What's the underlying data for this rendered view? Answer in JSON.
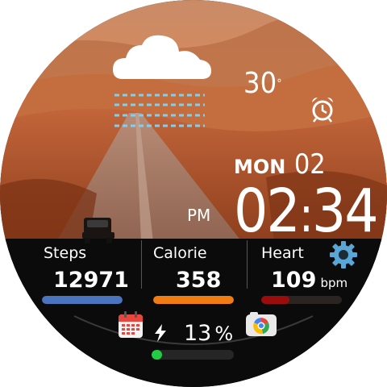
{
  "weather": {
    "icon": "rain-cloud-icon",
    "temperature": "30",
    "unit": "°"
  },
  "alarm": {
    "icon": "alarm-clock-icon"
  },
  "date": {
    "weekday": "MON",
    "day": "02"
  },
  "time": {
    "ampm": "PM",
    "hours": "02",
    "separator": ":",
    "minutes": "34"
  },
  "settings": {
    "icon": "gear-icon"
  },
  "stats": {
    "steps": {
      "label": "Steps",
      "value": "12971",
      "progress": 1.0,
      "color": "#4a74bf"
    },
    "calorie": {
      "label": "Calorie",
      "value": "358",
      "progress": 1.0,
      "color": "#f07c12"
    },
    "heart": {
      "label": "Heart",
      "value": "109",
      "unit": "bpm",
      "progress": 0.35,
      "color": "#9b0c0c"
    }
  },
  "battery": {
    "icon": "charging-bolt-icon",
    "value": "13",
    "unit": "%",
    "progress": 0.13,
    "color": "#22cc44"
  },
  "shortcuts": [
    {
      "name": "calendar-app-icon"
    },
    {
      "name": "camera-app-icon"
    }
  ],
  "colors": {
    "text": "#ffffff",
    "rain": "#7fd0ee",
    "gear": "#5aa6d6"
  }
}
